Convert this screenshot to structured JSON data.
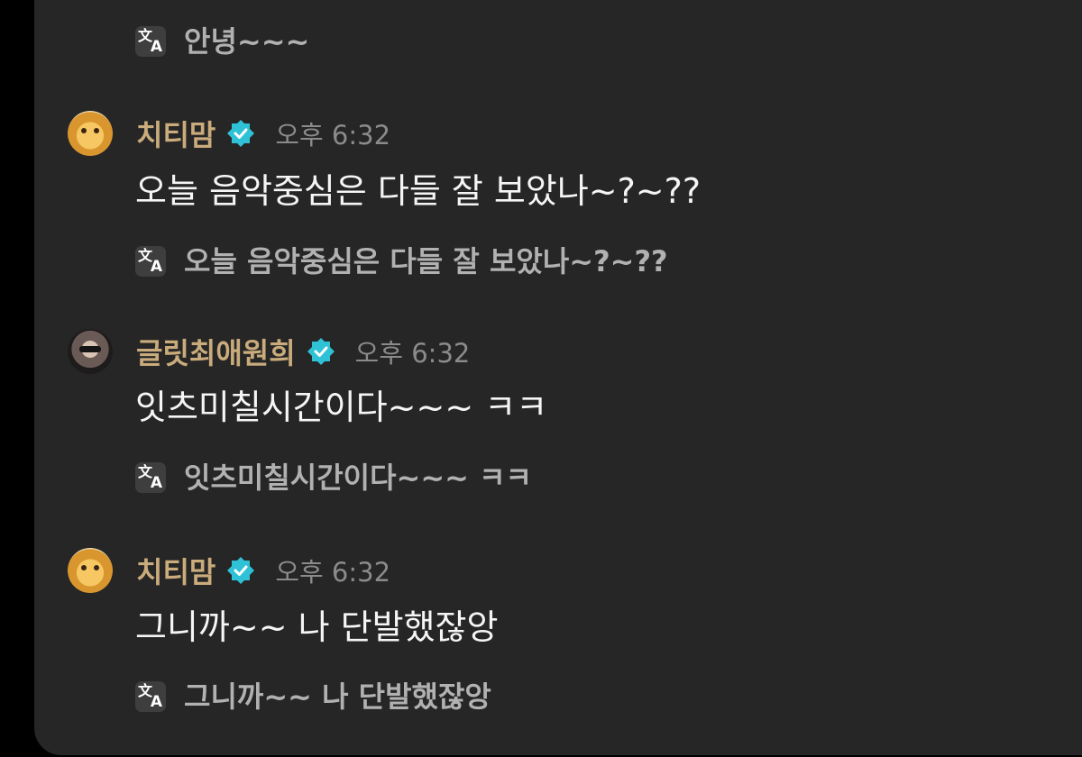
{
  "icons": {
    "translate": "translate-icon",
    "verified": "verified-badge-icon",
    "translate_glyph_han": "文",
    "translate_glyph_latin": "A"
  },
  "colors": {
    "background": "#262626",
    "username": "#c9ab7c",
    "verified_badge": "#2fc1d6",
    "message_text": "#f5f5f5",
    "translation_text": "#b1b1b1",
    "timestamp": "#8b8b8b"
  },
  "chat": {
    "top_translation": "안녕~~~",
    "messages": [
      {
        "username": "치티맘",
        "verified": true,
        "time": "오후 6:32",
        "text": "오늘 음악중심은 다들 잘 보았나~?~??",
        "translation": "오늘 음악중심은 다들 잘 보았나~?~??"
      },
      {
        "username": "글릿최애원희",
        "verified": true,
        "time": "오후 6:32",
        "text": "잇츠미칠시간이다~~~ ㅋㅋ",
        "translation": "잇츠미칠시간이다~~~ ㅋㅋ"
      },
      {
        "username": "치티맘",
        "verified": true,
        "time": "오후 6:32",
        "text": "그니까~~ 나 단발했잖앙",
        "translation": "그니까~~ 나 단발했잖앙"
      }
    ]
  }
}
